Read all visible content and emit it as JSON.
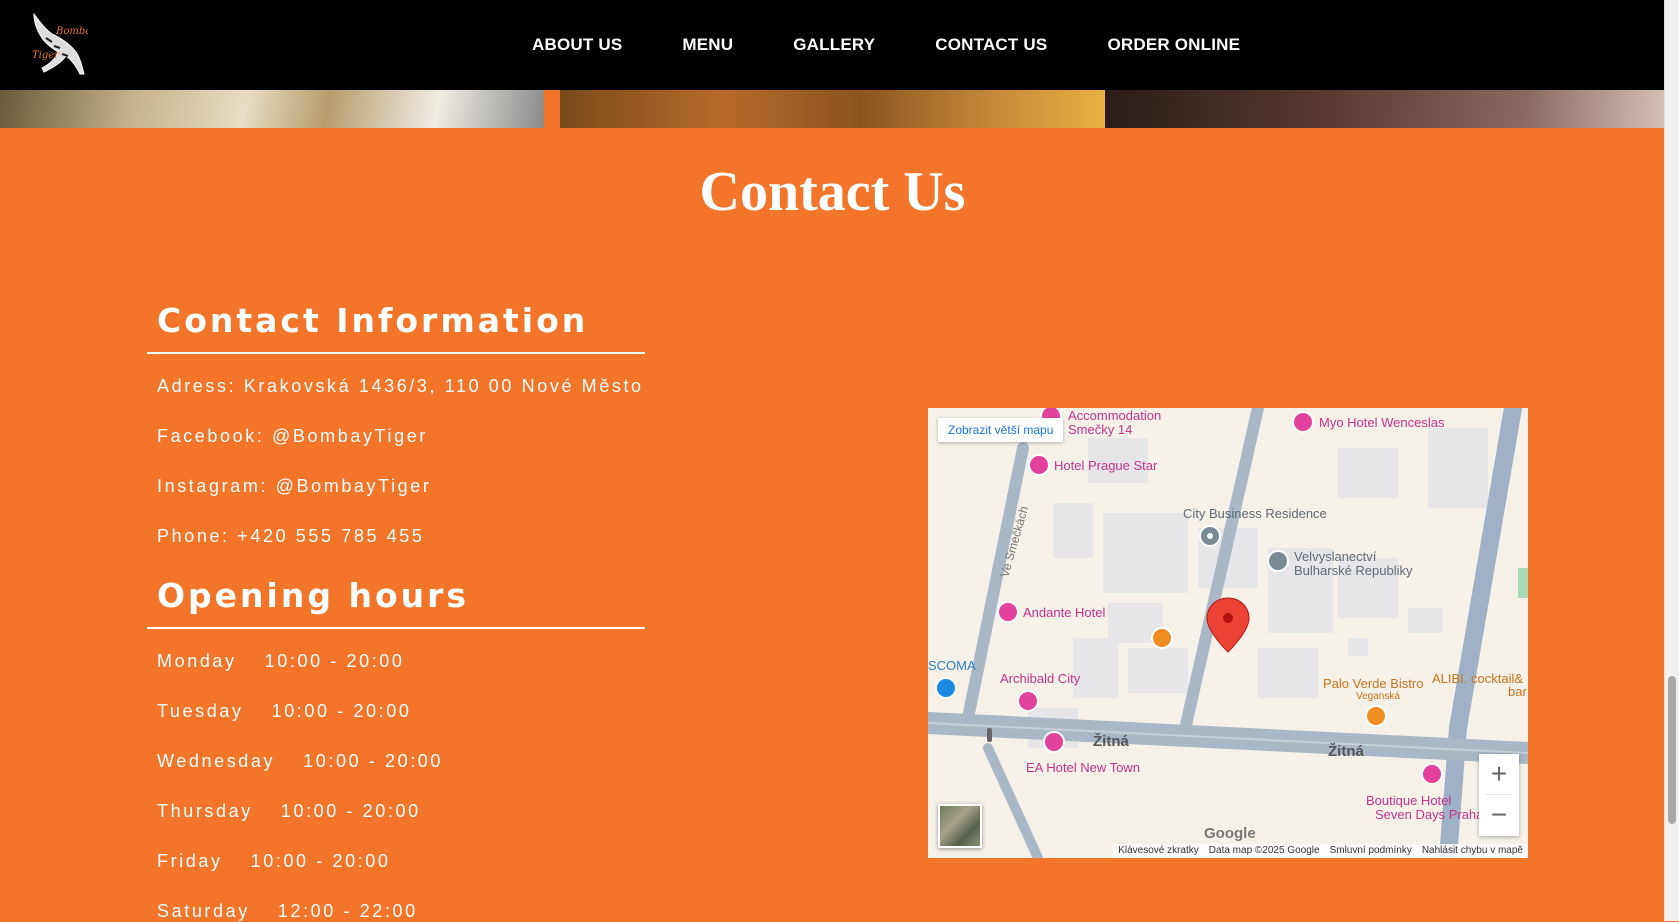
{
  "nav": {
    "items": [
      "ABOUT US",
      "MENU",
      "GALLERY",
      "CONTACT US",
      "ORDER ONLINE"
    ],
    "logo_text": [
      "Bombay",
      "Tiger"
    ]
  },
  "page_title": "Contact Us",
  "contact": {
    "heading": "Contact Information",
    "address": "Adress: Krakovská 1436/3, 110 00 Nové Město",
    "facebook": "Facebook: @BombayTiger",
    "instagram": "Instagram: @BombayTiger",
    "phone": "Phone: +420 555 785 455"
  },
  "hours": {
    "heading": "Opening hours",
    "days": [
      {
        "day": "Monday",
        "time": "10:00 - 20:00"
      },
      {
        "day": "Tuesday",
        "time": "10:00 - 20:00"
      },
      {
        "day": "Wednesday",
        "time": "10:00 - 20:00"
      },
      {
        "day": "Thursday",
        "time": "10:00 - 20:00"
      },
      {
        "day": "Friday",
        "time": "10:00 - 20:00"
      },
      {
        "day": "Saturday",
        "time": "12:00 - 22:00"
      }
    ]
  },
  "map": {
    "view_larger": "Zobrazit větší mapu",
    "labels": {
      "accommodation": [
        "Accommodation",
        "Smečky 14"
      ],
      "myo": "Myo Hotel Wenceslas",
      "prague_star": "Hotel Prague Star",
      "city_business": "City Business Residence",
      "embassy": [
        "Velvyslanectví",
        "Bulharské Republiky"
      ],
      "street_smeckach": "Ve Smečkách",
      "andante": "Andante Hotel",
      "scoma": "SCOMA",
      "archibald": "Archibald City",
      "palo_verde": "Palo Verde Bistro",
      "palo_verde_sub": "Veganská",
      "alibi": [
        "ALIBI. cocktail&",
        "bar"
      ],
      "zitna": "Žitná",
      "ea_hotel": "EA Hotel New Town",
      "boutique": [
        "Boutique Hotel",
        "Seven Days Praha"
      ]
    },
    "google": "Google",
    "zoom_in": "+",
    "zoom_out": "−",
    "footer": [
      "Klávesové zkratky",
      "Data map ©2025 Google",
      "Smluvní podmínky",
      "Nahlásit chybu v mapě"
    ],
    "colors": {
      "hotel_pin": "#e2429b",
      "food_pin": "#f08c24",
      "marker": "#ea4335",
      "road": "#aab7c6"
    }
  }
}
